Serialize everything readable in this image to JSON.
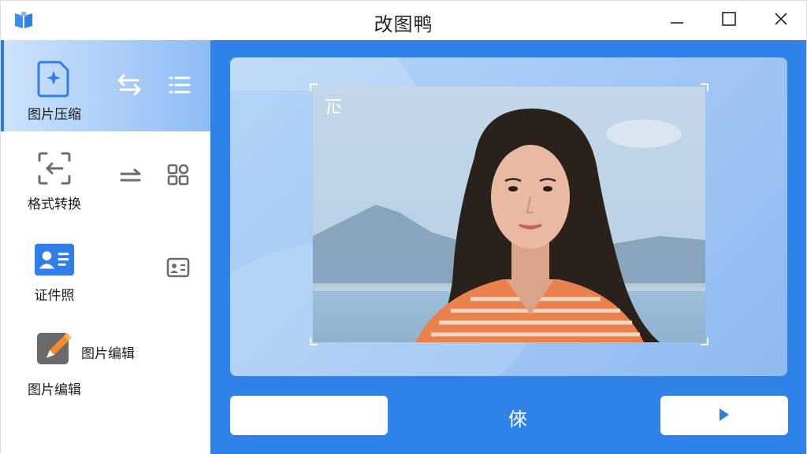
{
  "app": {
    "title": "改图鸭",
    "logo_icon": "book-logo-icon"
  },
  "window_controls": [
    "minimize-icon",
    "maximize-icon",
    "close-icon"
  ],
  "sidebar": {
    "rows": [
      {
        "label": "图片压缩",
        "icon": "image-compress-icon",
        "extras": [
          "swap-arrows-icon",
          "list-icon"
        ],
        "active": true
      },
      {
        "label": "格式转换",
        "icon": "format-convert-icon",
        "extras": [
          "arrow-right-icon",
          "grid-apps-icon"
        ]
      },
      {
        "label": "证件照",
        "icon": "id-card-icon",
        "extras": [
          "contact-card-icon"
        ]
      },
      {
        "label": "图片编辑",
        "icon": "image-edit-icon",
        "extra_label": "图片编辑"
      }
    ]
  },
  "preview": {
    "watermark_icon": "watermark-icon"
  },
  "bottom": {
    "center_mark": "倈",
    "right_button_icon": "play-icon"
  },
  "colors": {
    "accent": "#2f83e8",
    "active_row": "#8ebcf4",
    "preview_bg": "#a4c9f4"
  }
}
